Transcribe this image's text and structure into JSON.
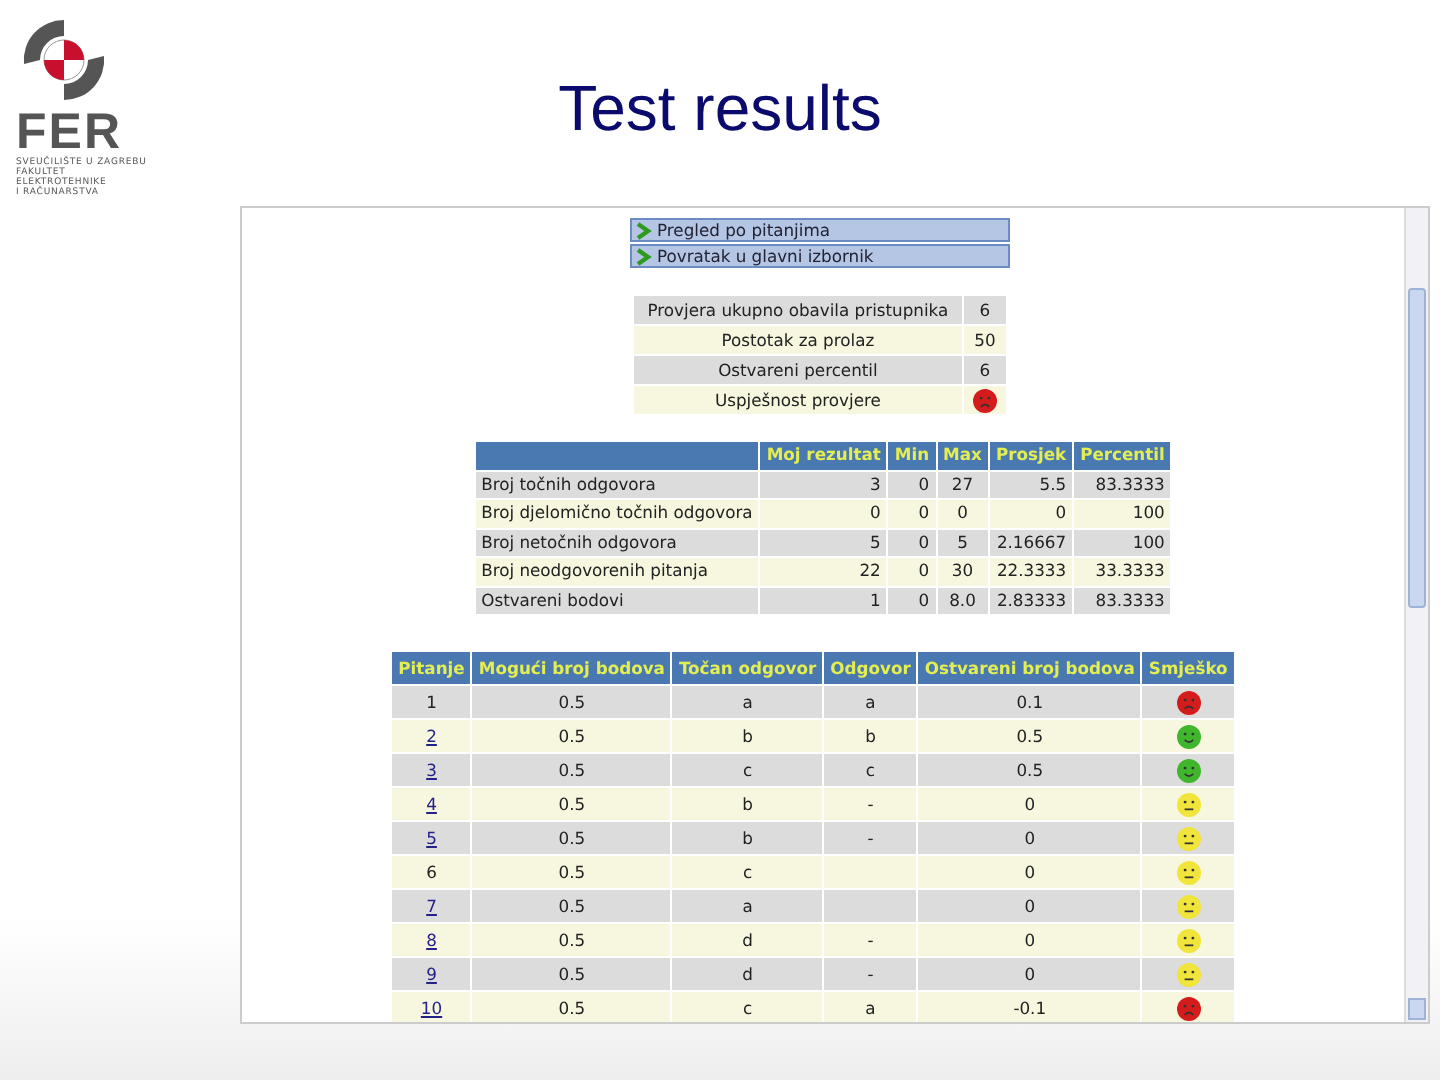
{
  "slide": {
    "title": "Test results",
    "logo": {
      "wordmark": "FER",
      "lines": [
        "SVEUČILIŠTE U ZAGREBU",
        "FAKULTET",
        "ELEKTROTEHNIKE",
        "I RAČUNARSTVA"
      ]
    }
  },
  "menu": [
    "Pregled po pitanjima",
    "Povratak u glavni izbornik"
  ],
  "summary": [
    {
      "label": "Provjera ukupno obavila pristupnika",
      "value": "6"
    },
    {
      "label": "Postotak za prolaz",
      "value": "50"
    },
    {
      "label": "Ostvareni percentil",
      "value": "6"
    },
    {
      "label": "Uspješnost provjere",
      "smiley": {
        "kind": "sad",
        "color": "#d41c1c"
      }
    }
  ],
  "stats": {
    "columns": [
      "",
      "Moj rezultat",
      "Min",
      "Max",
      "Prosjek",
      "Percentil"
    ],
    "rows": [
      [
        "Broj točnih odgovora",
        "3",
        "0",
        "27",
        "5.5",
        "83.3333"
      ],
      [
        "Broj djelomično točnih odgovora",
        "0",
        "0",
        "0",
        "0",
        "100"
      ],
      [
        "Broj netočnih odgovora",
        "5",
        "0",
        "5",
        "2.16667",
        "100"
      ],
      [
        "Broj neodgovorenih pitanja",
        "22",
        "0",
        "30",
        "22.3333",
        "33.3333"
      ],
      [
        "Ostvareni bodovi",
        "1",
        "0",
        "8.0",
        "2.83333",
        "83.3333"
      ]
    ]
  },
  "questions": {
    "columns": [
      "Pitanje",
      "Mogući broj bodova",
      "Točan odgovor",
      "Odgovor",
      "Ostvareni broj bodova",
      "Smješko"
    ],
    "rows": [
      {
        "n": "1",
        "link": false,
        "max": "0.5",
        "correct": "a",
        "answer": "a",
        "points": "0.1",
        "smiley": {
          "kind": "sad",
          "color": "#d41c1c"
        }
      },
      {
        "n": "2",
        "link": true,
        "max": "0.5",
        "correct": "b",
        "answer": "b",
        "points": "0.5",
        "smiley": {
          "kind": "happy",
          "color": "#3fb62c"
        }
      },
      {
        "n": "3",
        "link": true,
        "max": "0.5",
        "correct": "c",
        "answer": "c",
        "points": "0.5",
        "smiley": {
          "kind": "happy",
          "color": "#3fb62c"
        }
      },
      {
        "n": "4",
        "link": true,
        "max": "0.5",
        "correct": "b",
        "answer": "-",
        "points": "0",
        "smiley": {
          "kind": "neutral",
          "color": "#f1e43a"
        }
      },
      {
        "n": "5",
        "link": true,
        "max": "0.5",
        "correct": "b",
        "answer": "-",
        "points": "0",
        "smiley": {
          "kind": "neutral",
          "color": "#f1e43a"
        }
      },
      {
        "n": "6",
        "link": false,
        "max": "0.5",
        "correct": "c",
        "answer": "",
        "points": "0",
        "smiley": {
          "kind": "neutral",
          "color": "#f1e43a"
        }
      },
      {
        "n": "7",
        "link": true,
        "max": "0.5",
        "correct": "a",
        "answer": "",
        "points": "0",
        "smiley": {
          "kind": "neutral",
          "color": "#f1e43a"
        }
      },
      {
        "n": "8",
        "link": true,
        "max": "0.5",
        "correct": "d",
        "answer": "-",
        "points": "0",
        "smiley": {
          "kind": "neutral",
          "color": "#f1e43a"
        }
      },
      {
        "n": "9",
        "link": true,
        "max": "0.5",
        "correct": "d",
        "answer": "-",
        "points": "0",
        "smiley": {
          "kind": "neutral",
          "color": "#f1e43a"
        }
      },
      {
        "n": "10",
        "link": true,
        "max": "0.5",
        "correct": "c",
        "answer": "a",
        "points": "-0.1",
        "smiley": {
          "kind": "sad",
          "color": "#d41c1c"
        }
      }
    ]
  }
}
